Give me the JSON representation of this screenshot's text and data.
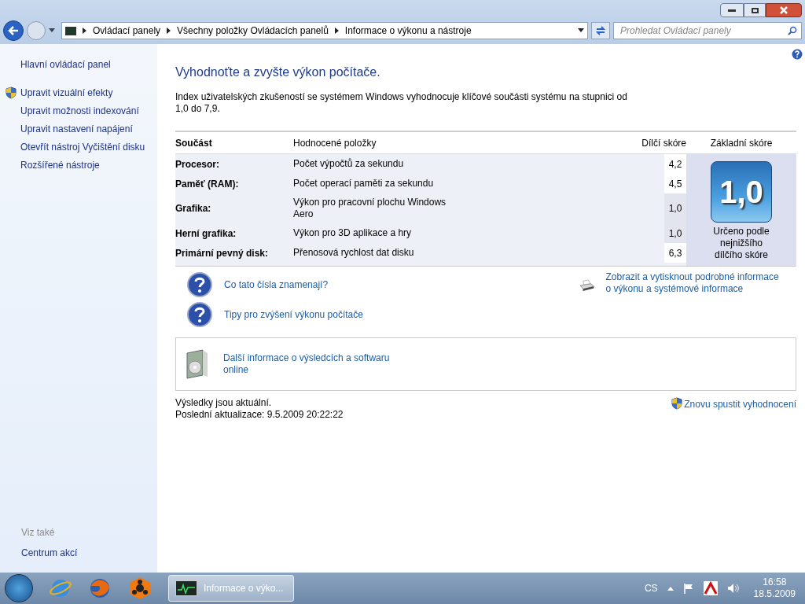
{
  "breadcrumb": [
    "Ovládací panely",
    "Všechny položky Ovládacích panelů",
    "Informace o výkonu a nástroje"
  ],
  "search": {
    "placeholder": "Prohledat Ovládací panely"
  },
  "sidebar": {
    "items": [
      {
        "label": "Hlavní ovládací panel",
        "shield": false
      },
      {
        "label": "Upravit vizuální efekty",
        "shield": true
      },
      {
        "label": "Upravit možnosti indexování",
        "shield": false
      },
      {
        "label": "Upravit nastavení napájení",
        "shield": false
      },
      {
        "label": "Otevřít nástroj Vyčištění disku",
        "shield": false
      },
      {
        "label": "Rozšířené nástroje",
        "shield": false
      }
    ],
    "see_also_heading": "Viz také",
    "see_also": [
      "Centrum akcí"
    ]
  },
  "heading": "Vyhodnoťte a zvyšte výkon počítače.",
  "intro": "Index uživatelských zkušeností se systémem Windows vyhodnocuje klíčové součásti systému na stupnici od 1,0 do 7,9.",
  "table": {
    "columns": [
      "Součást",
      "Hodnocené položky",
      "Dílčí skóre",
      "Základní skóre"
    ],
    "rows": [
      {
        "component": "Procesor:",
        "item": "Počet výpočtů za sekundu",
        "score": "4,2",
        "lowest": false
      },
      {
        "component": "Paměť (RAM):",
        "item": "Počet operací paměti za sekundu",
        "score": "4,5",
        "lowest": false
      },
      {
        "component": "Grafika:",
        "item": "Výkon pro pracovní plochu Windows Aero",
        "score": "1,0",
        "lowest": true
      },
      {
        "component": "Herní grafika:",
        "item": "Výkon pro 3D aplikace a hry",
        "score": "1,0",
        "lowest": true
      },
      {
        "component": "Primární pevný disk:",
        "item": "Přenosová rychlost dat disku",
        "score": "6,3",
        "lowest": false
      }
    ],
    "base_score": "1,0",
    "base_caption": "Určeno podle nejnižšího dílčího skóre"
  },
  "help_links": [
    "Co tato čísla znamenají?",
    "Tipy pro zvýšení výkonu počítače"
  ],
  "print_link": "Zobrazit a vytisknout podrobné informace o výkonu a systémové informace",
  "online_link": "Další informace o výsledcích a softwaru online",
  "status": [
    "Výsledky jsou aktuální.",
    "Poslední aktualizace: 9.5.2009 20:22:22"
  ],
  "rerun_link": "Znovu spustit vyhodnocení",
  "taskbar": {
    "window": "Informace o výko...",
    "language": "CS",
    "time": "16:58",
    "date": "18.5.2009"
  }
}
